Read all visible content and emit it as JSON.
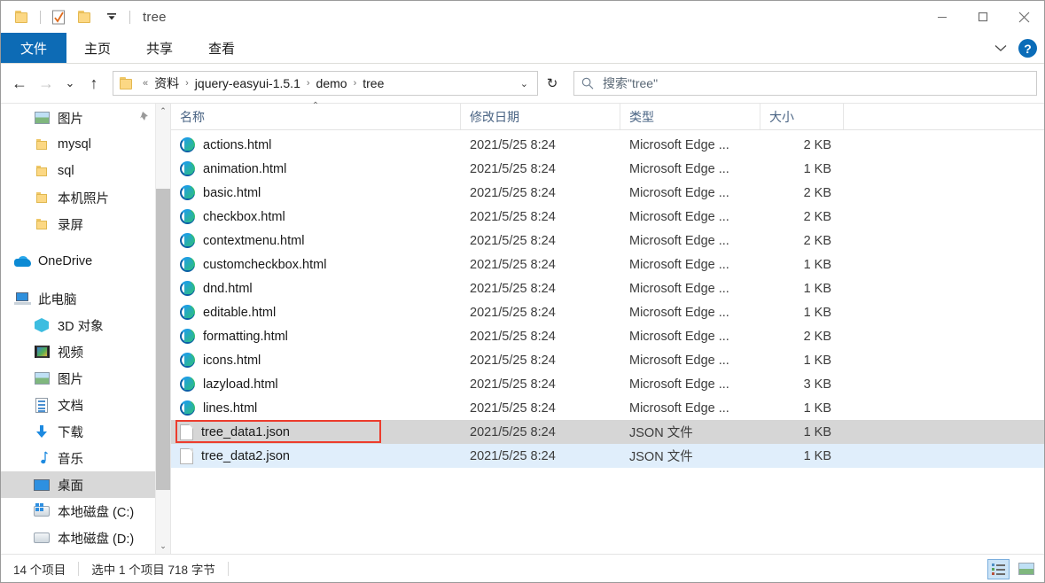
{
  "window": {
    "title": "tree",
    "quick_access": [
      {
        "name": "folder-icon",
        "label": ""
      },
      {
        "name": "properties-icon",
        "label": ""
      },
      {
        "name": "new-folder-icon",
        "label": ""
      },
      {
        "name": "customize-dropdown-icon",
        "label": "▼"
      }
    ],
    "minimize_label": "—",
    "maximize_label": "□",
    "close_label": "✕"
  },
  "ribbon": {
    "tabs": [
      {
        "label": "文件",
        "active": true
      },
      {
        "label": "主页",
        "active": false
      },
      {
        "label": "共享",
        "active": false
      },
      {
        "label": "查看",
        "active": false
      }
    ],
    "expand_label": "⌄",
    "help_label": "?"
  },
  "nav": {
    "back_label": "←",
    "forward_label": "→",
    "recent_label": "⌄",
    "up_label": "↑",
    "refresh_label": "↻",
    "breadcrumb_prefix": "«",
    "breadcrumbs": [
      "资料",
      "jquery-easyui-1.5.1",
      "demo",
      "tree"
    ],
    "breadcrumb_separator": "›",
    "breadcrumb_dropdown": "⌄"
  },
  "search": {
    "placeholder": "搜索\"tree\"",
    "value": "",
    "icon": "search-icon"
  },
  "sidebar": {
    "items": [
      {
        "label": "图片",
        "icon": "picture-icon",
        "indent": 1,
        "pinned": true,
        "pin_glyph": "📌"
      },
      {
        "label": "mysql",
        "icon": "folder-icon",
        "indent": 1
      },
      {
        "label": "sql",
        "icon": "folder-icon",
        "indent": 1
      },
      {
        "label": "本机照片",
        "icon": "folder-icon",
        "indent": 1
      },
      {
        "label": "录屏",
        "icon": "folder-icon",
        "indent": 1
      },
      {
        "label": "OneDrive",
        "icon": "onedrive-icon",
        "indent": 0,
        "gap_before": true
      },
      {
        "label": "此电脑",
        "icon": "this-pc-icon",
        "indent": 0,
        "gap_before": true
      },
      {
        "label": "3D 对象",
        "icon": "3d-objects-icon",
        "indent": 1
      },
      {
        "label": "视频",
        "icon": "videos-icon",
        "indent": 1
      },
      {
        "label": "图片",
        "icon": "pictures-icon",
        "indent": 1
      },
      {
        "label": "文档",
        "icon": "documents-icon",
        "indent": 1
      },
      {
        "label": "下载",
        "icon": "downloads-icon",
        "indent": 1
      },
      {
        "label": "音乐",
        "icon": "music-icon",
        "indent": 1
      },
      {
        "label": "桌面",
        "icon": "desktop-icon",
        "indent": 1,
        "selected": true
      },
      {
        "label": "本地磁盘 (C:)",
        "icon": "system-drive-icon",
        "indent": 1
      },
      {
        "label": "本地磁盘 (D:)",
        "icon": "drive-icon",
        "indent": 1
      }
    ],
    "scroll_up_glyph": "⌃",
    "scroll_down_glyph": "⌄"
  },
  "list": {
    "columns": [
      {
        "key": "name",
        "label": "名称",
        "sorted": true,
        "sort_glyph": "⌃"
      },
      {
        "key": "date",
        "label": "修改日期"
      },
      {
        "key": "type",
        "label": "类型"
      },
      {
        "key": "size",
        "label": "大小"
      }
    ],
    "rows": [
      {
        "name": "actions.html",
        "date": "2021/5/25 8:24",
        "type": "Microsoft Edge ...",
        "size": "2 KB",
        "icon": "edge-html-icon"
      },
      {
        "name": "animation.html",
        "date": "2021/5/25 8:24",
        "type": "Microsoft Edge ...",
        "size": "1 KB",
        "icon": "edge-html-icon"
      },
      {
        "name": "basic.html",
        "date": "2021/5/25 8:24",
        "type": "Microsoft Edge ...",
        "size": "2 KB",
        "icon": "edge-html-icon"
      },
      {
        "name": "checkbox.html",
        "date": "2021/5/25 8:24",
        "type": "Microsoft Edge ...",
        "size": "2 KB",
        "icon": "edge-html-icon"
      },
      {
        "name": "contextmenu.html",
        "date": "2021/5/25 8:24",
        "type": "Microsoft Edge ...",
        "size": "2 KB",
        "icon": "edge-html-icon"
      },
      {
        "name": "customcheckbox.html",
        "date": "2021/5/25 8:24",
        "type": "Microsoft Edge ...",
        "size": "1 KB",
        "icon": "edge-html-icon"
      },
      {
        "name": "dnd.html",
        "date": "2021/5/25 8:24",
        "type": "Microsoft Edge ...",
        "size": "1 KB",
        "icon": "edge-html-icon"
      },
      {
        "name": "editable.html",
        "date": "2021/5/25 8:24",
        "type": "Microsoft Edge ...",
        "size": "1 KB",
        "icon": "edge-html-icon"
      },
      {
        "name": "formatting.html",
        "date": "2021/5/25 8:24",
        "type": "Microsoft Edge ...",
        "size": "2 KB",
        "icon": "edge-html-icon"
      },
      {
        "name": "icons.html",
        "date": "2021/5/25 8:24",
        "type": "Microsoft Edge ...",
        "size": "1 KB",
        "icon": "edge-html-icon"
      },
      {
        "name": "lazyload.html",
        "date": "2021/5/25 8:24",
        "type": "Microsoft Edge ...",
        "size": "3 KB",
        "icon": "edge-html-icon"
      },
      {
        "name": "lines.html",
        "date": "2021/5/25 8:24",
        "type": "Microsoft Edge ...",
        "size": "1 KB",
        "icon": "edge-html-icon"
      },
      {
        "name": "tree_data1.json",
        "date": "2021/5/25 8:24",
        "type": "JSON 文件",
        "size": "1 KB",
        "icon": "json-file-icon",
        "state": "selected-focused"
      },
      {
        "name": "tree_data2.json",
        "date": "2021/5/25 8:24",
        "type": "JSON 文件",
        "size": "1 KB",
        "icon": "json-file-icon",
        "state": "selected"
      }
    ]
  },
  "status": {
    "item_count": "14 个项目",
    "selection": "选中 1 个项目  718 字节",
    "view_details_icon": "details-view-icon",
    "view_large_icon": "large-icons-view-icon"
  }
}
